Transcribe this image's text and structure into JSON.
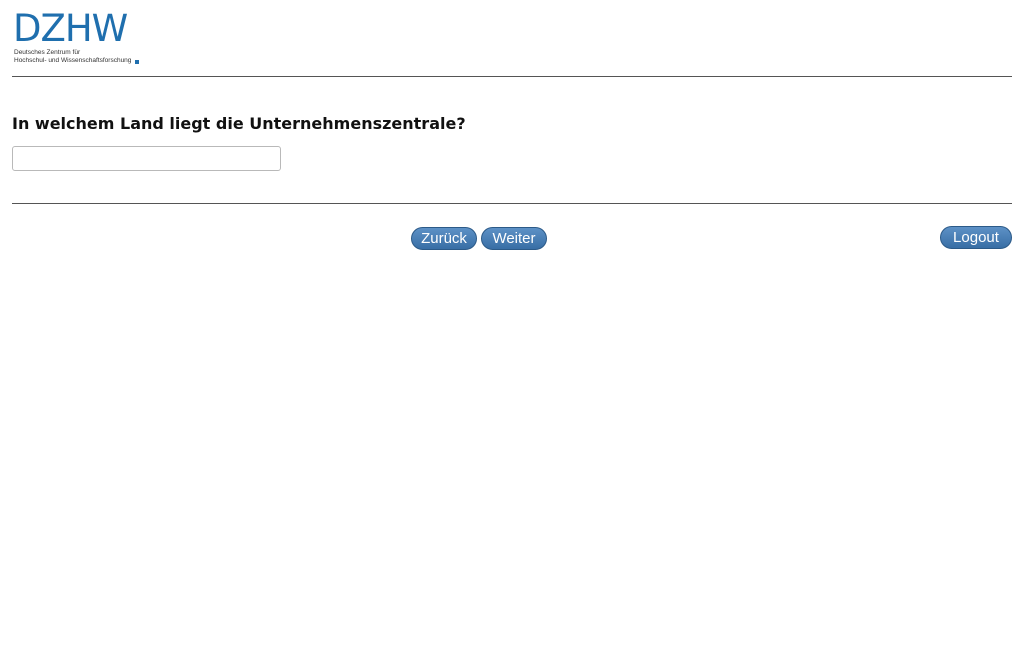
{
  "logo": {
    "wordmark": "DZHW",
    "subtitle_line1": "Deutsches Zentrum für",
    "subtitle_line2": "Hochschul- und Wissenschaftsforschung",
    "brand_color": "#1f6fae"
  },
  "question": {
    "text": "In welchem Land liegt die Unternehmenszentrale?"
  },
  "answer": {
    "value": "",
    "placeholder": ""
  },
  "navigation": {
    "back_label": "Zurück",
    "next_label": "Weiter",
    "logout_label": "Logout",
    "button_color": "#4a80b8"
  }
}
